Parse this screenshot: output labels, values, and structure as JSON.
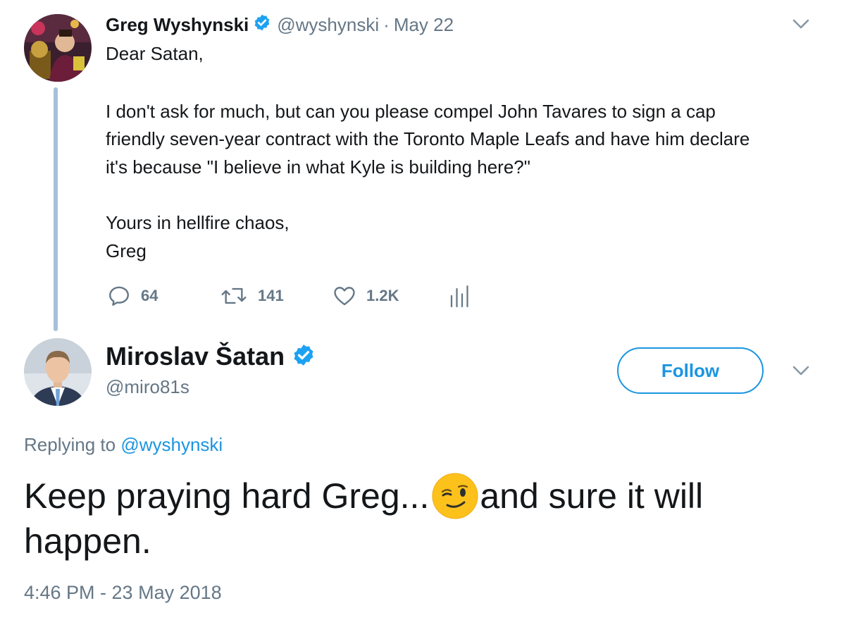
{
  "parent_tweet": {
    "author_name": "Greg Wyshynski",
    "handle": "@wyshynski",
    "separator": "·",
    "date": "May 22",
    "verified": true,
    "text_lines": [
      "Dear Satan,",
      "I don't ask for much, but can you please compel John Tavares to sign a cap",
      "friendly seven-year contract with the Toronto Maple Leafs and have him declare",
      "it's because \"I believe in what Kyle is building here?\"",
      "Yours in hellfire chaos,",
      "Greg"
    ],
    "actions": {
      "replies": "64",
      "retweets": "141",
      "likes": "1.2K"
    }
  },
  "reply_tweet": {
    "author_name": "Miroslav Šatan",
    "handle": "@miro81s",
    "verified": true,
    "follow_label": "Follow",
    "replying_prefix": "Replying to",
    "replying_handle": "@wyshynski",
    "text_before_emoji": "Keep praying hard Greg...",
    "emoji": "winking-face",
    "text_after_emoji": "and sure it will",
    "text_line2": "happen.",
    "timestamp": "4:46 PM - 23 May 2018"
  },
  "colors": {
    "text": "#14171a",
    "secondary": "#657786",
    "link": "#1b95e0",
    "verified": "#1da1f2",
    "thread_line": "#a9bfd8"
  }
}
